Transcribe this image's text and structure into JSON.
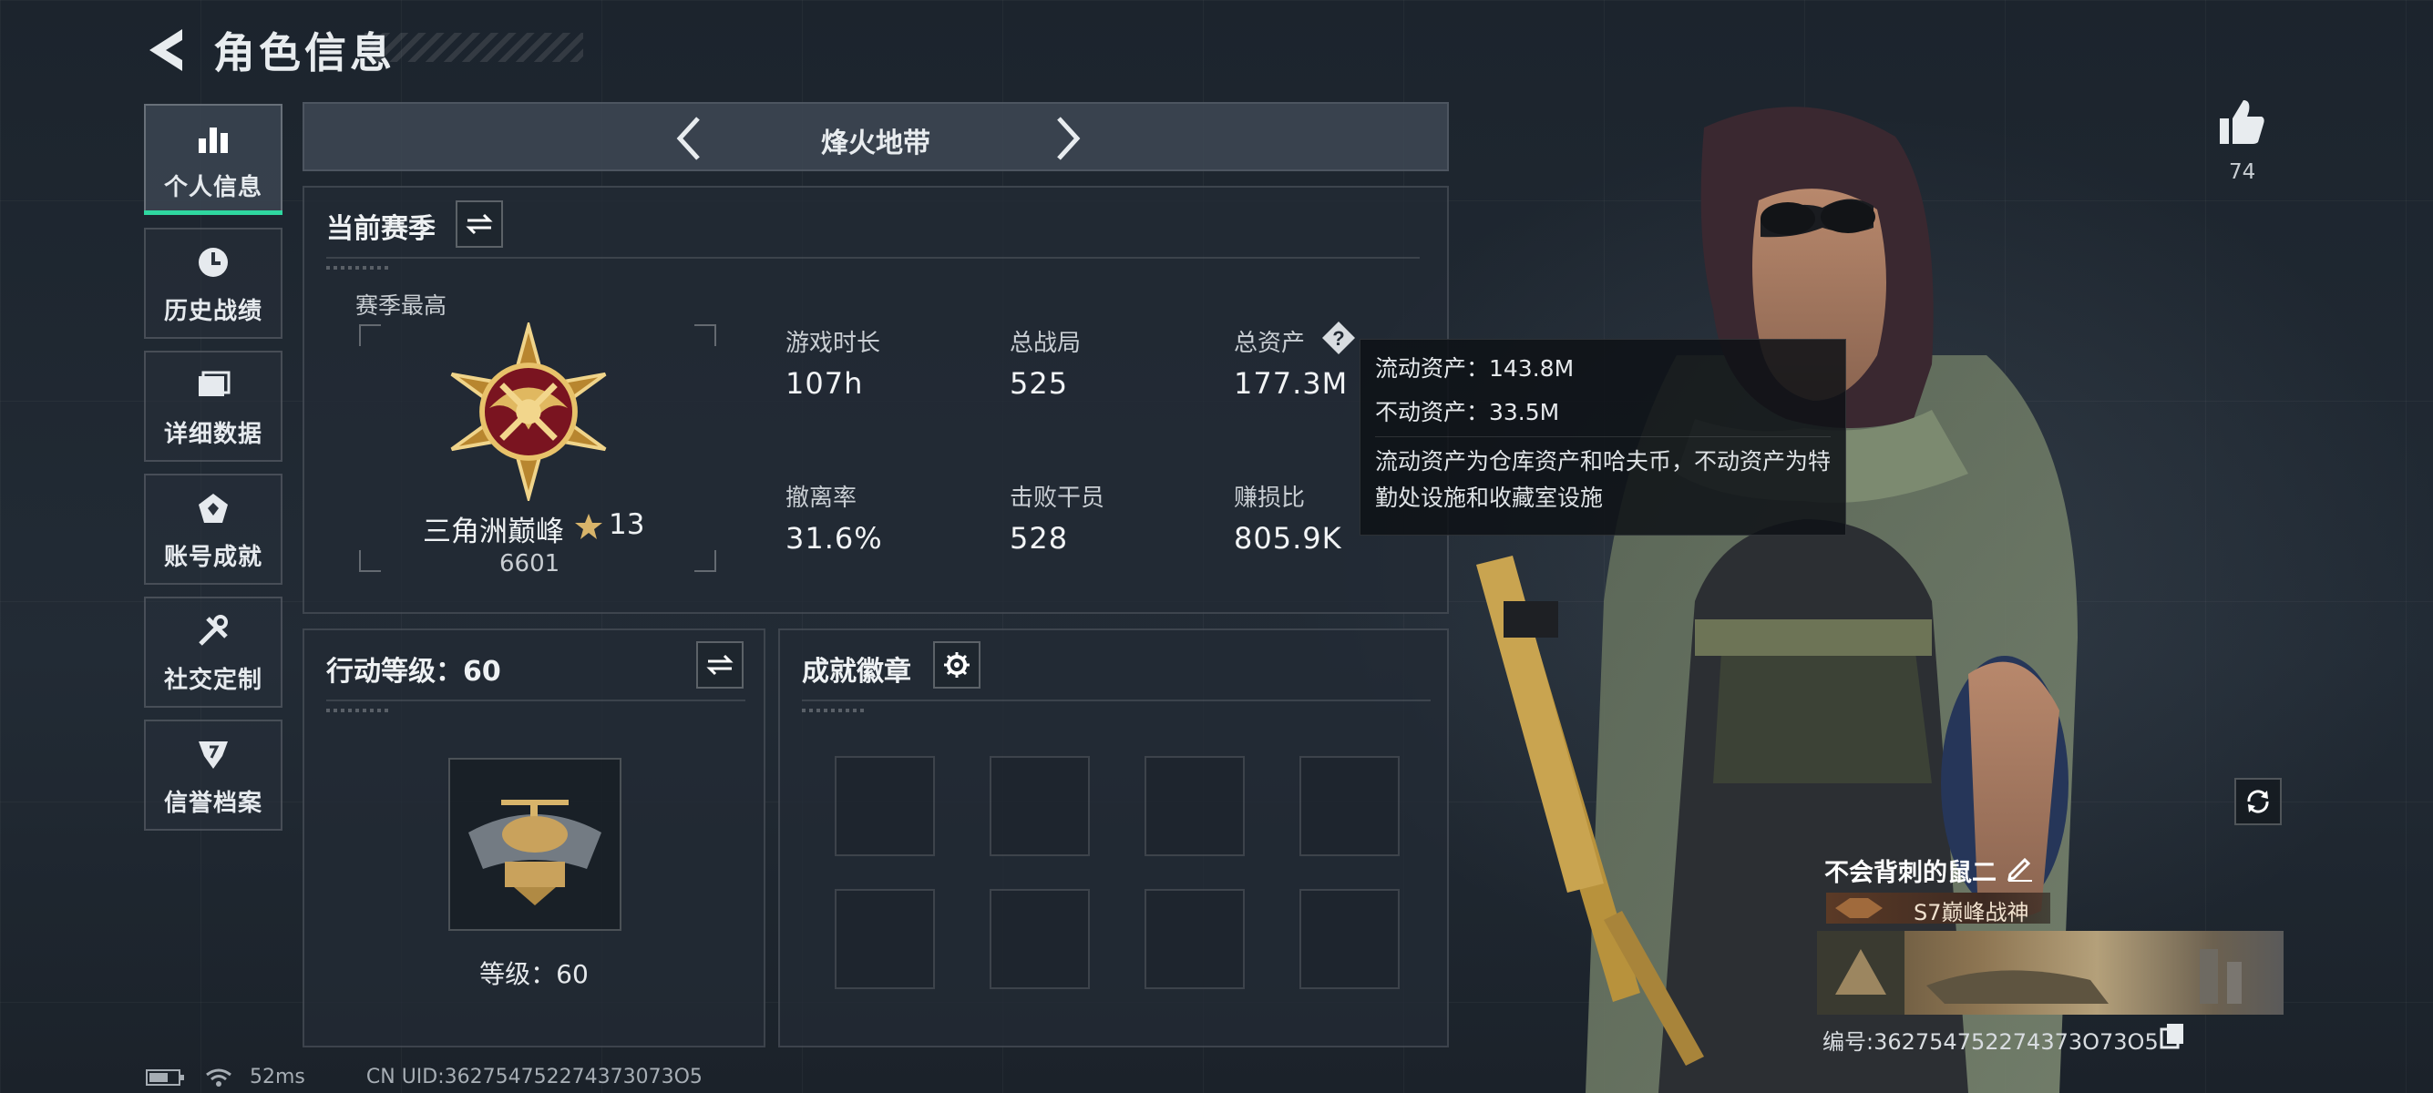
{
  "header": {
    "title": "角色信息"
  },
  "nav": {
    "items": [
      {
        "label": "个人信息",
        "icon": "bar-chart-icon",
        "active": true
      },
      {
        "label": "历史战绩",
        "icon": "clock-icon",
        "active": false
      },
      {
        "label": "详细数据",
        "icon": "folder-icon",
        "active": false
      },
      {
        "label": "账号成就",
        "icon": "medal-icon",
        "active": false
      },
      {
        "label": "社交定制",
        "icon": "wrench-icon",
        "active": false
      },
      {
        "label": "信誉档案",
        "icon": "shield-icon",
        "active": false
      }
    ]
  },
  "mode": {
    "label": "烽火地带"
  },
  "season": {
    "title": "当前赛季",
    "best_label": "赛季最高",
    "rank_name": "三角洲巅峰",
    "rank_stars": "13",
    "rank_points": "6601",
    "stats": [
      {
        "label": "游戏时长",
        "value": "107h"
      },
      {
        "label": "总战局",
        "value": "525"
      },
      {
        "label": "总资产",
        "value": "177.3M"
      },
      {
        "label": "撤离率",
        "value": "31.6%"
      },
      {
        "label": "击败干员",
        "value": "528"
      },
      {
        "label": "赚损比",
        "value": "805.9K"
      }
    ]
  },
  "tooltip": {
    "liquid": "流动资产：143.8M",
    "fixed": "不动资产：33.5M",
    "desc": "流动资产为仓库资产和哈夫币，不动资产为特勤处设施和收藏室设施"
  },
  "level": {
    "title": "行动等级：60",
    "caption": "等级：60"
  },
  "achievements": {
    "title": "成就徽章",
    "slots": 8
  },
  "status": {
    "ping": "52ms",
    "uid": "CN UID:362754752274373073O5"
  },
  "profile": {
    "likes": "74",
    "name": "不会背刺的鼠二",
    "title": "S7巅峰战神",
    "id": "编号:362754752274373O73O5"
  },
  "colors": {
    "accent": "#2fd7a0",
    "gold": "#d8b46a",
    "panel": "#222a34"
  }
}
